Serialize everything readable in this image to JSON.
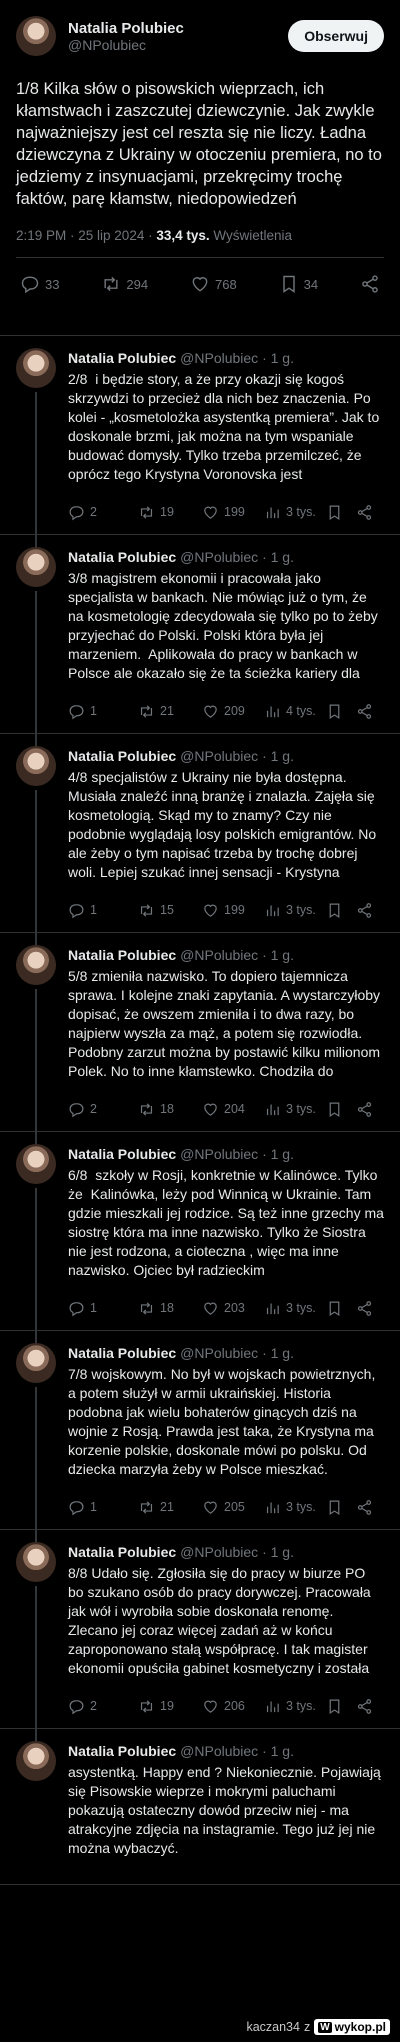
{
  "main_tweet": {
    "author_name": "Natalia Polubiec",
    "author_handle": "@NPolubiec",
    "follow_label": "Obserwuj",
    "text": "1/8 Kilka słów o pisowskich wieprzach, ich kłamstwach i zaszczutej dziewczynie. Jak zwykle najważniejszy jest cel reszta się nie liczy. Ładna dziewczyna z Ukrainy w otoczeniu premiera, no to jedziemy z insynuacjami, przekręcimy trochę faktów, parę kłamstw, niedopowiedzeń",
    "time": "2:19 PM · 25 lip 2024 · ",
    "views": "33,4 tys.",
    "views_label": " Wyświetlenia",
    "replies": "33",
    "reposts": "294",
    "likes": "768",
    "bookmarks": "34"
  },
  "replies": [
    {
      "name": "Natalia Polubiec",
      "meta": "@NPolubiec · 1 g.",
      "text": "2/8  i będzie story, a że przy okazji się kogoś skrzywdzi to przecież dla nich bez znaczenia. Po kolei - „kosmetolożka asystentką premiera”. Jak to doskonale brzmi, jak można na tym wspaniale budować domysły. Tylko trzeba przemilczeć, że oprócz tego Krystyna Voronovska jest",
      "replies": "2",
      "reposts": "19",
      "likes": "199",
      "views": "3 tys."
    },
    {
      "name": "Natalia Polubiec",
      "meta": "@NPolubiec · 1 g.",
      "text": "3/8 magistrem ekonomii i pracowała jako specjalista w bankach. Nie mówiąc już o tym, że na kosmetologię zdecydowała się tylko po to żeby przyjechać do Polski. Polski która była jej marzeniem.  Aplikowała do pracy w bankach w Polsce ale okazało się że ta ścieżka kariery dla",
      "replies": "1",
      "reposts": "21",
      "likes": "209",
      "views": "4 tys."
    },
    {
      "name": "Natalia Polubiec",
      "meta": "@NPolubiec · 1 g.",
      "text": "4/8 specjalistów z Ukrainy nie była dostępna. Musiała znaleźć inną branżę i znalazła. Zajęła się kosmetologią. Skąd my to znamy? Czy nie podobnie wyglądają losy polskich emigrantów. No ale żeby o tym napisać trzeba by trochę dobrej woli. Lepiej szukać innej sensacji - Krystyna",
      "replies": "1",
      "reposts": "15",
      "likes": "199",
      "views": "3 tys."
    },
    {
      "name": "Natalia Polubiec",
      "meta": "@NPolubiec · 1 g.",
      "text": "5/8 zmieniła nazwisko. To dopiero tajemnicza sprawa. I kolejne znaki zapytania. A wystarczyłoby dopisać, że owszem zmieniła i to dwa razy, bo najpierw wyszła za mąż, a potem się rozwiodła. Podobny zarzut można by postawić kilku milionom Polek. No to inne kłamstewko. Chodziła do",
      "replies": "2",
      "reposts": "18",
      "likes": "204",
      "views": "3 tys."
    },
    {
      "name": "Natalia Polubiec",
      "meta": "@NPolubiec · 1 g.",
      "text": "6/8  szkoły w Rosji, konkretnie w Kalinówce. Tylko że  Kalinówka, leży pod Winnicą w Ukrainie. Tam gdzie mieszkali jej rodzice. Są też inne grzechy ma siostrę która ma inne nazwisko. Tylko że Siostra nie jest rodzona, a cioteczna , więc ma inne nazwisko. Ojciec był radzieckim",
      "replies": "1",
      "reposts": "18",
      "likes": "203",
      "views": "3 tys."
    },
    {
      "name": "Natalia Polubiec",
      "meta": "@NPolubiec · 1 g.",
      "text": "7/8 wojskowym. No był w wojskach powietrznych, a potem służył w armii ukraińskiej. Historia podobna jak wielu bohaterów ginących dziś na wojnie z Rosją. Prawda jest taka, że Krystyna ma korzenie polskie, doskonale mówi po polsku. Od dziecka marzyła żeby w Polsce mieszkać.",
      "replies": "1",
      "reposts": "21",
      "likes": "205",
      "views": "3 tys."
    },
    {
      "name": "Natalia Polubiec",
      "meta": "@NPolubiec · 1 g.",
      "text": "8/8 Udało się. Zgłosiła się do pracy w biurze PO bo szukano osób do pracy dorywczej. Pracowała jak wół i wyrobiła sobie doskonała renomę. Zlecano jej coraz więcej zadań aż w końcu zaproponowano stałą współpracę. I tak magister ekonomii opuściła gabinet kosmetyczny i została",
      "replies": "2",
      "reposts": "19",
      "likes": "206",
      "views": "3 tys."
    },
    {
      "name": "Natalia Polubiec",
      "meta": "@NPolubiec · 1 g.",
      "text": "asystentką. Happy end ? Niekoniecznie. Pojawiają się Pisowskie wieprze i mokrymi paluchami pokazują ostateczny dowód przeciw niej - ma atrakcyjne zdjęcia na instagramie. Tego już jej nie można wybaczyć."
    }
  ],
  "footer": {
    "user": "kaczan34",
    "sep": "z",
    "site": "wykop.pl"
  }
}
